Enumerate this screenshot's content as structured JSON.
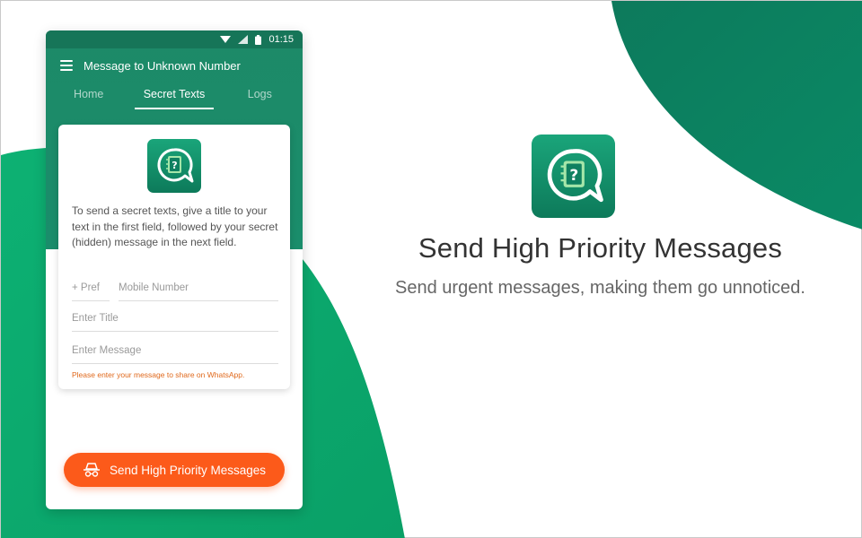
{
  "colors": {
    "brand_green": "#1a8d6b",
    "blob_green": "#0aae6e",
    "accent_orange": "#fc5a1a",
    "hint_orange": "#e0691c"
  },
  "status_bar": {
    "time": "01:15",
    "icons": [
      "wifi-icon",
      "signal-icon",
      "battery-icon"
    ]
  },
  "app_bar": {
    "title": "Message to Unknown Number",
    "menu_icon": "menu-icon"
  },
  "tabs": [
    {
      "label": "Home",
      "active": false
    },
    {
      "label": "Secret Texts",
      "active": true
    },
    {
      "label": "Logs",
      "active": false
    }
  ],
  "card": {
    "icon": "secret-notebook-chat-icon",
    "description": "To send a secret texts, give a title to your text in the first field, followed by your secret (hidden) message in the next field.",
    "fields": {
      "prefix_placeholder": "+ Pref",
      "mobile_placeholder": "Mobile Number",
      "title_placeholder": "Enter Title",
      "message_placeholder": "Enter Message"
    },
    "hint": "Please enter your message to share on WhatsApp."
  },
  "send_button": {
    "label": "Send High Priority Messages",
    "icon": "incognito-icon"
  },
  "hero": {
    "icon": "secret-notebook-chat-icon",
    "title": "Send High Priority Messages",
    "subtitle": "Send urgent messages, making them go unnoticed."
  }
}
